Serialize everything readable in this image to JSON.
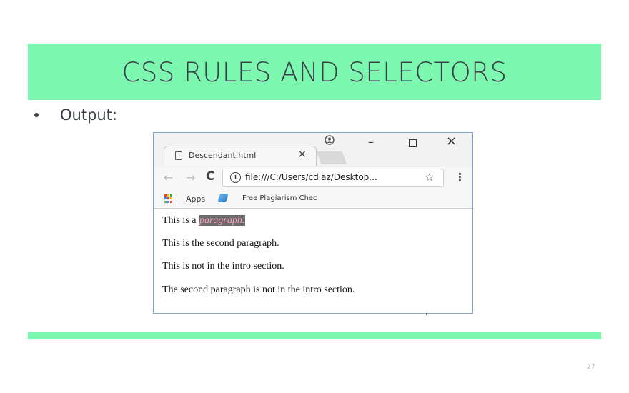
{
  "slide": {
    "title": "CSS RULES AND SELECTORS",
    "bullet": "Output:",
    "page_number": "27"
  },
  "browser": {
    "tab": {
      "title": "Descendant.html",
      "close": "×"
    },
    "window_controls": {
      "profile": "⛭",
      "minimize": "–",
      "close": "×"
    },
    "toolbar": {
      "back": "←",
      "forward": "→",
      "reload": "C",
      "url": "file:///C:/Users/cdiaz/Desktop...",
      "star": "☆",
      "menu": "⋮"
    },
    "bookmarks": {
      "apps_label": "Apps",
      "bookmark_label": "Free Plagiarism Chec"
    },
    "content": {
      "paragraph_1_prefix": "This is a ",
      "paragraph_1_highlight": "paragraph.",
      "paragraph_2": "This is the second paragraph.",
      "paragraph_3": "This is not in the intro section.",
      "paragraph_4": "The second paragraph is not in the intro section."
    }
  },
  "colors": {
    "accent_bar": "#7cf7b0",
    "title_text": "#3a3f47",
    "highlight_bg": "#6a6a6a",
    "highlight_text": "#ff9fc4",
    "window_border": "#7aa6d6"
  },
  "icons": {
    "tab_doc": "document-icon",
    "profile": "profile-icon",
    "info": "info-icon",
    "star": "star-icon",
    "apps": "apps-grid-icon",
    "bookmark": "bookmark-favicon-icon"
  }
}
